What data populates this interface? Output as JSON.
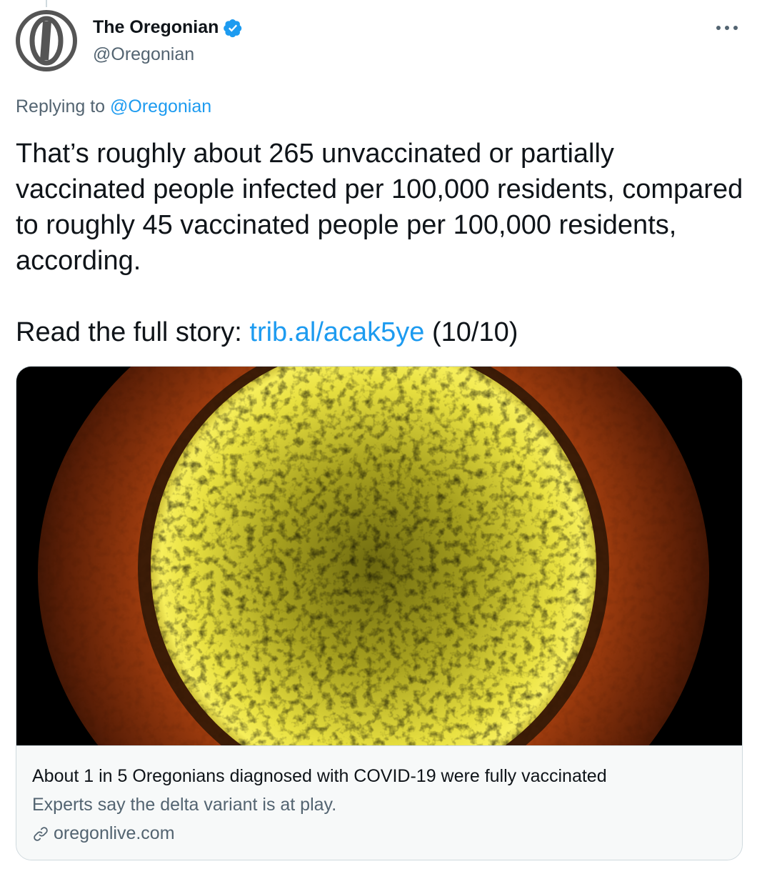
{
  "author": {
    "name": "The Oregonian",
    "handle": "@Oregonian",
    "verified": true,
    "avatar_icon": "oregonian-o-logo"
  },
  "more_icon": "more-horizontal-icon",
  "more_label": "···",
  "reply": {
    "prefix": "Replying to ",
    "handle": "@Oregonian"
  },
  "tweet": {
    "paragraph1": "That’s roughly about 265 unvaccinated or partially vaccinated people infected per 100,000 residents, compared to roughly 45 vaccinated people per 100,000 residents, according.",
    "prefix": "Read the full story: ",
    "link": "trib.al/acak5ye",
    "suffix": " (10/10)"
  },
  "card": {
    "image_description": "coronavirus-micrograph",
    "title": "About 1 in 5 Oregonians diagnosed with COVID-19 were fully vaccinated",
    "description": "Experts say the delta variant is at play.",
    "domain": "oregonlive.com",
    "domain_icon": "link-icon"
  },
  "colors": {
    "link": "#1d9bf0",
    "secondary_text": "#536471",
    "primary_text": "#0f1419",
    "border": "#cfd9de",
    "card_background": "#f7f9f9",
    "verified_badge": "#1d9bf0"
  }
}
